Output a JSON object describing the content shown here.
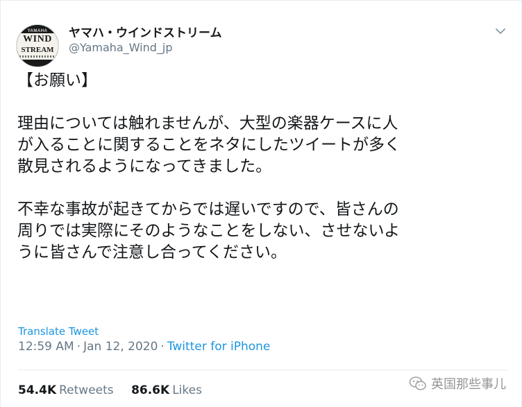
{
  "tweet": {
    "avatar": {
      "brand_top": "YAMAHA",
      "line1": "WIND",
      "line2": "STREAM"
    },
    "display_name": "ヤマハ・ウインドストリーム",
    "handle": "@Yamaha_Wind_jp",
    "paragraphs": [
      [
        "【お願い】"
      ],
      [
        "理由については触れませんが、大型の楽器ケースに人",
        "が入ることに関することをネタにしたツイートが多く",
        "散見されるようになってきました。"
      ],
      [
        "不幸な事故が起きてからでは遅いですので、皆さんの",
        "周りでは実際にそのようなことをしない、させないよ",
        "うに皆さんで注意し合ってください。"
      ]
    ],
    "translate_label": "Translate Tweet",
    "time": "12:59 AM",
    "date": "Jan 12, 2020",
    "separator": "·",
    "source": "Twitter for iPhone",
    "retweets_count": "54.4K",
    "retweets_label": "Retweets",
    "likes_count": "86.6K",
    "likes_label": "Likes",
    "caret_icon": "chevron-down-icon"
  },
  "watermark": {
    "text": "英国那些事儿",
    "icon": "wechat-icon"
  },
  "colors": {
    "text": "#14171a",
    "secondary": "#657786",
    "link": "#1b95e0",
    "border": "#e6ecf0"
  }
}
